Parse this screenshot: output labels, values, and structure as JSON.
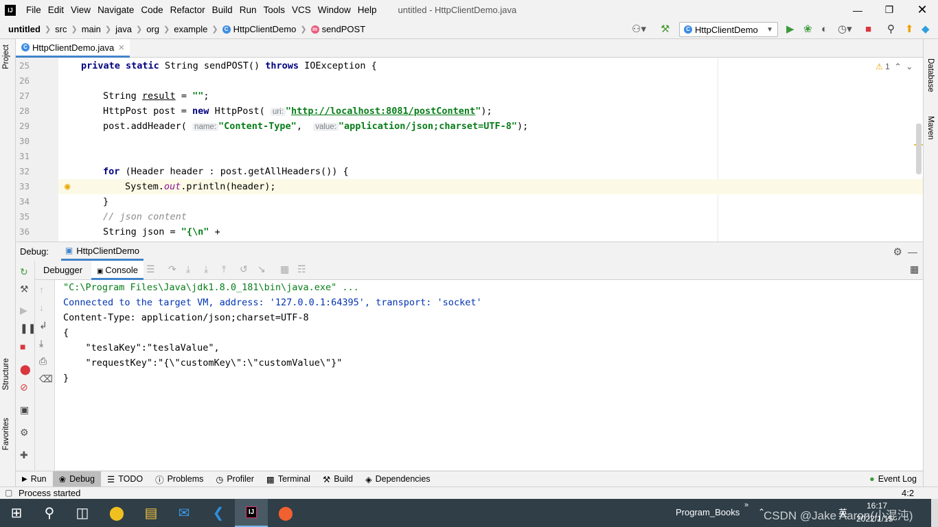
{
  "menubar": {
    "logo": "IJ",
    "items": [
      "File",
      "Edit",
      "View",
      "Navigate",
      "Code",
      "Refactor",
      "Build",
      "Run",
      "Tools",
      "VCS",
      "Window",
      "Help"
    ],
    "window_title": "untitled - HttpClientDemo.java"
  },
  "breadcrumb": [
    "untitled",
    "src",
    "main",
    "java",
    "org",
    "example",
    "HttpClientDemo",
    "sendPOST"
  ],
  "run_config": "HttpClientDemo",
  "editor_tab": "HttpClientDemo.java",
  "warning_count": "1",
  "side_tools": {
    "project": "Project",
    "structure": "Structure",
    "favorites": "Favorites",
    "database": "Database",
    "maven": "Maven"
  },
  "code_lines": [
    {
      "num": "25"
    },
    {
      "num": "26"
    },
    {
      "num": "27"
    },
    {
      "num": "28"
    },
    {
      "num": "29"
    },
    {
      "num": "30"
    },
    {
      "num": "31"
    },
    {
      "num": "32"
    },
    {
      "num": "33"
    },
    {
      "num": "34"
    },
    {
      "num": "35"
    },
    {
      "num": "36"
    }
  ],
  "code": {
    "l25_a": "private static",
    "l25_b": " String sendPOST() ",
    "l25_c": "throws",
    "l25_d": " IOException {",
    "l27_a": "String ",
    "l27_b": "result",
    "l27_c": " = ",
    "l27_d": "\"\"",
    "l27_e": ";",
    "l28_a": "HttpPost post = ",
    "l28_b": "new",
    "l28_c": " HttpPost( ",
    "l28_hint": "uri:",
    "l28_q1": "\"",
    "l28_url": "http://localhost:8081/postContent",
    "l28_q2": "\"",
    "l28_end": ");",
    "l29_a": "post.addHeader( ",
    "l29_hint1": "name:",
    "l29_s1": "\"Content-Type\"",
    "l29_b": ",  ",
    "l29_hint2": "value:",
    "l29_s2": "\"application/json;charset=UTF-8\"",
    "l29_end": ");",
    "l32_a": "for",
    "l32_b": " (Header header : post.getAllHeaders()) {",
    "l33_a": "System.",
    "l33_b": "out",
    "l33_c": ".println(header);",
    "l34": "}",
    "l35": "// json content",
    "l36_a": "String json = ",
    "l36_s": "\"{\\n\"",
    "l36_b": " +"
  },
  "debug": {
    "label": "Debug:",
    "session_tab": "HttpClientDemo",
    "tabs": [
      "Debugger",
      "Console"
    ]
  },
  "console": [
    "\"C:\\Program Files\\Java\\jdk1.8.0_181\\bin\\java.exe\" ...",
    "Connected to the target VM, address: '127.0.0.1:64395', transport: 'socket'",
    "Content-Type: application/json;charset=UTF-8",
    "{",
    "    \"teslaKey\":\"teslaValue\",",
    "    \"requestKey\":\"{\\\"customKey\\\":\\\"customValue\\\"}\"",
    "}"
  ],
  "bottom_tabs": [
    "Run",
    "Debug",
    "TODO",
    "Problems",
    "Profiler",
    "Terminal",
    "Build",
    "Dependencies"
  ],
  "event_log": "Event Log",
  "status": {
    "text": "Process started",
    "position": "4:2"
  },
  "taskbar": {
    "tray_label": "Program_Books",
    "ime": "英",
    "time": "16:17",
    "date": "2022/1/15",
    "watermark": "CSDN @Jake Aaron(小混沌)"
  },
  "colors": {
    "accent": "#4083c9",
    "keyword": "#000080",
    "string": "#067d17",
    "taskbar": "#2f3e47"
  }
}
